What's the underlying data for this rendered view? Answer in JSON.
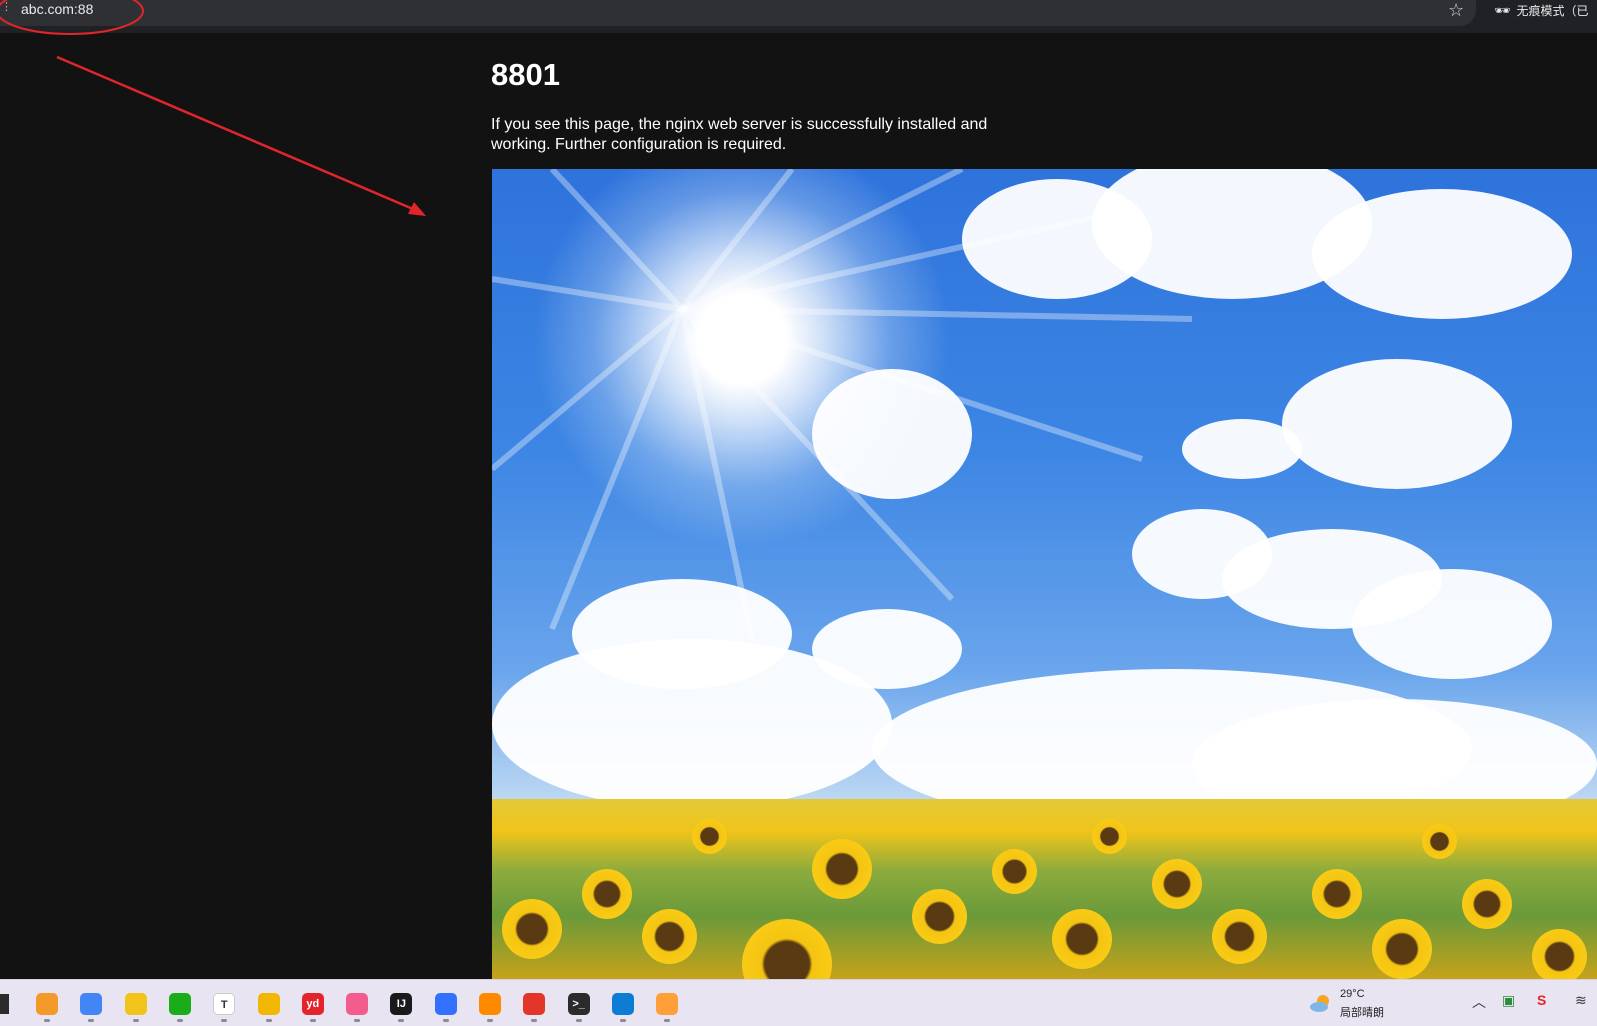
{
  "browser": {
    "url": "abc.com:88",
    "incognito_label": "无痕模式（已",
    "bookmark_icon": "star-icon",
    "menu_icon": "menu-dots-icon"
  },
  "page": {
    "heading": "8801",
    "body_text": "If you see this page, the nginx web server is successfully installed and working. Further configuration is required."
  },
  "annotation": {
    "circle_color": "#e0262b",
    "arrow_color": "#e0262b"
  },
  "taskbar": {
    "apps": [
      {
        "name": "app-1-icon",
        "glyph": "",
        "color": "#f39a2a"
      },
      {
        "name": "chrome-icon",
        "glyph": "",
        "color": "#4285f4"
      },
      {
        "name": "app-3-icon",
        "glyph": "",
        "color": "#f2c41b"
      },
      {
        "name": "wechat-icon",
        "glyph": "",
        "color": "#1aad19"
      },
      {
        "name": "typora-icon",
        "glyph": "T",
        "color": "#ffffff"
      },
      {
        "name": "file-explorer-icon",
        "glyph": "",
        "color": "#f2b705"
      },
      {
        "name": "youdao-icon",
        "glyph": "yd",
        "color": "#e4242b"
      },
      {
        "name": "bilibili-icon",
        "glyph": "",
        "color": "#f25d8e"
      },
      {
        "name": "intellij-icon",
        "glyph": "IJ",
        "color": "#1a1a1a"
      },
      {
        "name": "feishu-icon",
        "glyph": "",
        "color": "#3370ff"
      },
      {
        "name": "app-11-icon",
        "glyph": "",
        "color": "#ff8a00"
      },
      {
        "name": "app-12-icon",
        "glyph": "",
        "color": "#e4352b"
      },
      {
        "name": "terminal-icon",
        "glyph": ">_",
        "color": "#2b2b2b"
      },
      {
        "name": "edge-icon",
        "glyph": "",
        "color": "#0c7cd5"
      },
      {
        "name": "app-15-icon",
        "glyph": "",
        "color": "#ff9f3a"
      }
    ],
    "weather": {
      "temperature": "29°C",
      "description": "局部晴朗"
    }
  }
}
